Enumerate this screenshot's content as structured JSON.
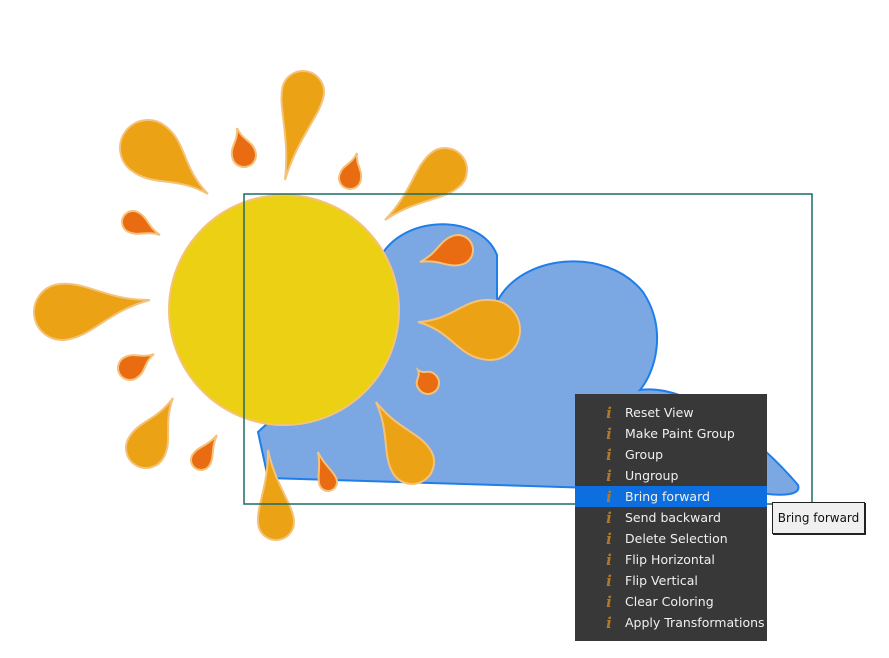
{
  "colors": {
    "sun": "#ecd013",
    "petal": "#eba215",
    "petal_small": "#ea6c12",
    "petal_stroke": "#f5c27a",
    "cloud": "#7ba7e2",
    "cloud_stroke": "#1f7ee8",
    "selection": "#1b6b66",
    "menu_bg": "#383838",
    "menu_highlight": "#0d6fdf"
  },
  "menu": {
    "items": [
      {
        "label": "Reset View",
        "icon": "info-icon"
      },
      {
        "label": "Make Paint Group",
        "icon": "info-icon"
      },
      {
        "label": "Group",
        "icon": "info-icon"
      },
      {
        "label": "Ungroup",
        "icon": "info-icon"
      },
      {
        "label": "Bring forward",
        "icon": "info-icon",
        "highlighted": true
      },
      {
        "label": "Send backward",
        "icon": "info-icon"
      },
      {
        "label": "Delete Selection",
        "icon": "info-icon"
      },
      {
        "label": "Flip Horizontal",
        "icon": "info-icon"
      },
      {
        "label": "Flip Vertical",
        "icon": "info-icon"
      },
      {
        "label": "Clear Coloring",
        "icon": "info-icon"
      },
      {
        "label": "Apply Transformations",
        "icon": "info-icon"
      }
    ]
  },
  "tooltip": {
    "text": "Bring forward"
  }
}
